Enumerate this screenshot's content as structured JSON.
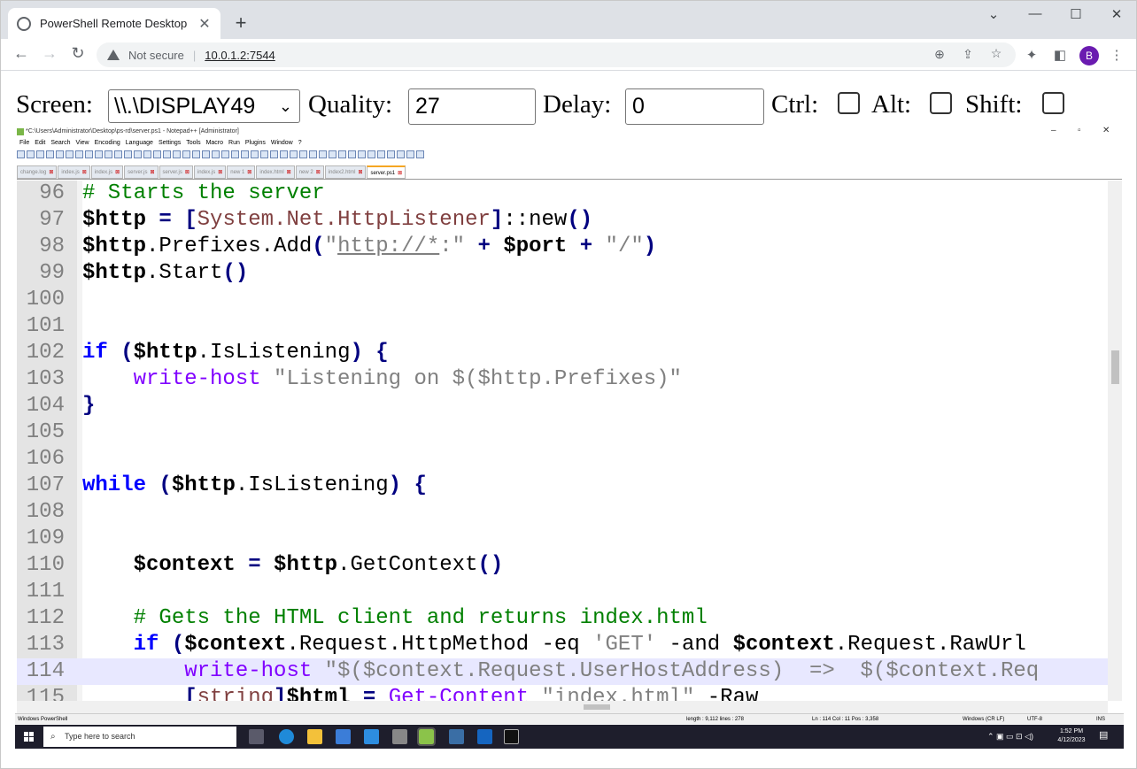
{
  "browser": {
    "tab_title": "PowerShell Remote Desktop",
    "new_tab": "+",
    "window_controls": [
      "⌄",
      "—",
      "☐",
      "✕"
    ],
    "security_label": "Not secure",
    "url": "10.0.1.2:7544",
    "avatar_letter": "B"
  },
  "controls": {
    "screen_label": "Screen:",
    "screen_value": "\\\\.\\DISPLAY49",
    "quality_label": "Quality:",
    "quality_value": "27",
    "delay_label": "Delay:",
    "delay_value": "0",
    "ctrl_label": "Ctrl:",
    "alt_label": "Alt:",
    "shift_label": "Shift:"
  },
  "notepad": {
    "title": "*C:\\Users\\Administrator\\Desktop\\ps-rd\\server.ps1 - Notepad++ [Administrator]",
    "menu": [
      "File",
      "Edit",
      "Search",
      "View",
      "Encoding",
      "Language",
      "Settings",
      "Tools",
      "Macro",
      "Run",
      "Plugins",
      "Window",
      "?"
    ],
    "tabs": [
      "change.log",
      "index.js",
      "index.js",
      "server.js",
      "server.js",
      "index.js",
      "new 1",
      "index.html",
      "new 2",
      "index2.html",
      "server.ps1"
    ],
    "active_tab": "server.ps1",
    "status": {
      "type": "Windows PowerShell",
      "length": "length : 9,112    lines : 278",
      "position": "Ln : 114    Col : 11    Pos : 3,358",
      "eol": "Windows (CR LF)",
      "encoding": "UTF-8",
      "mode": "INS"
    }
  },
  "code_lines": [
    {
      "n": "96"
    },
    {
      "n": "97"
    },
    {
      "n": "98"
    },
    {
      "n": "99"
    },
    {
      "n": "100"
    },
    {
      "n": "101"
    },
    {
      "n": "102"
    },
    {
      "n": "103"
    },
    {
      "n": "104"
    },
    {
      "n": "105"
    },
    {
      "n": "106"
    },
    {
      "n": "107"
    },
    {
      "n": "108"
    },
    {
      "n": "109"
    },
    {
      "n": "110"
    },
    {
      "n": "111"
    },
    {
      "n": "112"
    },
    {
      "n": "113"
    },
    {
      "n": "114"
    },
    {
      "n": "115"
    }
  ],
  "taskbar": {
    "search_placeholder": "Type here to search",
    "time": "1:52 PM",
    "date": "4/12/2023"
  }
}
